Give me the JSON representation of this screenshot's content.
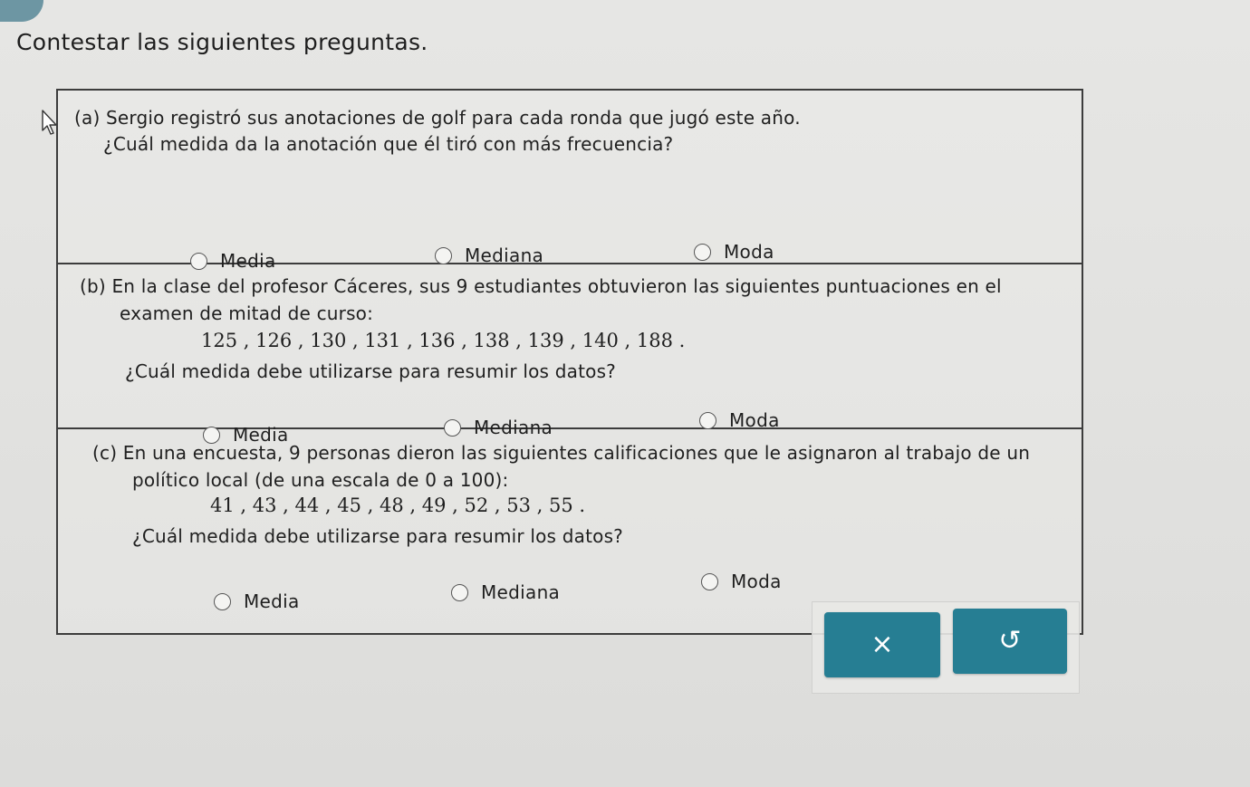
{
  "instruction": "Contestar las siguientes preguntas.",
  "questions": [
    {
      "id": "a",
      "lines": [
        "(a) Sergio registró sus anotaciones de golf para cada ronda que jugó este año.",
        "¿Cuál medida da la anotación que él tiró con más frecuencia?"
      ],
      "data": "",
      "prompt": "",
      "options": [
        "Media",
        "Mediana",
        "Moda"
      ]
    },
    {
      "id": "b",
      "lines": [
        "(b) En la clase del profesor Cáceres, sus 9 estudiantes obtuvieron las siguientes puntuaciones en el",
        "examen de mitad de curso:"
      ],
      "data": "125 , 126 , 130 , 131 , 136 , 138 , 139 , 140 , 188 .",
      "prompt": "¿Cuál medida debe utilizarse para resumir los datos?",
      "options": [
        "Media",
        "Mediana",
        "Moda"
      ]
    },
    {
      "id": "c",
      "lines": [
        "(c) En una encuesta, 9 personas dieron las siguientes calificaciones que le asignaron al trabajo de un",
        "político local (de una escala de 0 a 100):"
      ],
      "data": "41 , 43 , 44 , 45 , 48 , 49 , 52 , 53 , 55 .",
      "prompt": "¿Cuál medida debe utilizarse para resumir los datos?",
      "options": [
        "Media",
        "Mediana",
        "Moda"
      ]
    }
  ],
  "buttons": {
    "clear_icon": "×",
    "undo_icon": "↺"
  },
  "colors": {
    "button_bg": "#267e93",
    "corner_tab": "#6d96a3"
  },
  "icons": {
    "clear": "close-icon",
    "undo": "undo-icon",
    "cursor": "cursor-icon"
  }
}
